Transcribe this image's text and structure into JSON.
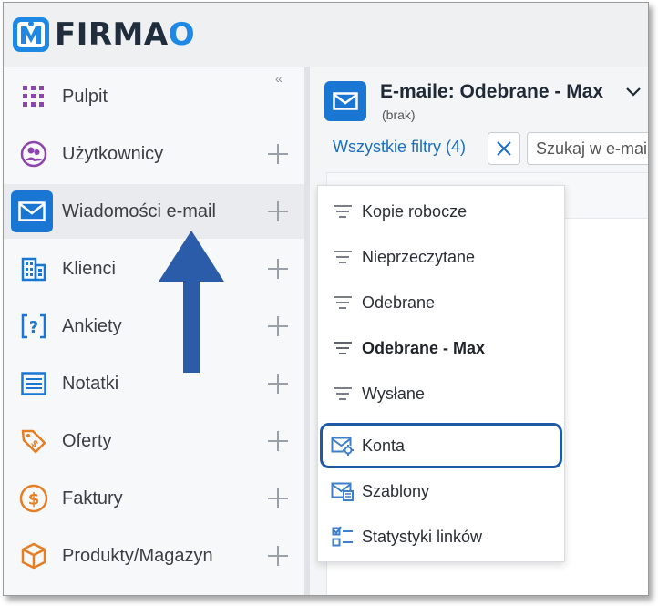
{
  "app": {
    "logo_text": "FIRMAO",
    "brand_color": "#1e88e5"
  },
  "sidebar": {
    "collapse_label": "«",
    "items": [
      {
        "label": "Pulpit",
        "icon": "grid-icon",
        "color": "#8e44ad",
        "has_add": false
      },
      {
        "label": "Użytkownicy",
        "icon": "users-icon",
        "color": "#8e44ad",
        "has_add": true
      },
      {
        "label": "Wiadomości e-mail",
        "icon": "mail-icon",
        "color": "#1976d2",
        "has_add": true,
        "active": true
      },
      {
        "label": "Klienci",
        "icon": "building-icon",
        "color": "#1976d2",
        "has_add": true
      },
      {
        "label": "Ankiety",
        "icon": "survey-icon",
        "color": "#1976d2",
        "has_add": true
      },
      {
        "label": "Notatki",
        "icon": "notes-icon",
        "color": "#1976d2",
        "has_add": true
      },
      {
        "label": "Oferty",
        "icon": "tag-icon",
        "color": "#e67e22",
        "has_add": true
      },
      {
        "label": "Faktury",
        "icon": "dollar-icon",
        "color": "#e67e22",
        "has_add": true
      },
      {
        "label": "Produkty/Magazyn",
        "icon": "box-icon",
        "color": "#e67e22",
        "has_add": true
      }
    ]
  },
  "content": {
    "title": "E-maile: Odebrane - Max",
    "subtitle": "(brak)",
    "filters_link": "Wszystkie filtry (4)",
    "search_placeholder": "Szukaj w e-mailach"
  },
  "menu": {
    "items": [
      {
        "label": "Kopie robocze",
        "icon": "filter-icon"
      },
      {
        "label": "Nieprzeczytane",
        "icon": "filter-icon"
      },
      {
        "label": "Odebrane",
        "icon": "filter-icon"
      },
      {
        "label": "Odebrane - Max",
        "icon": "filter-icon",
        "bold": true
      },
      {
        "label": "Wysłane",
        "icon": "filter-icon"
      },
      {
        "label": "Konta",
        "icon": "mail-settings-icon",
        "highlighted": true
      },
      {
        "label": "Szablony",
        "icon": "mail-template-icon"
      },
      {
        "label": "Statystyki linków",
        "icon": "checklist-icon"
      }
    ]
  },
  "annotation": {
    "arrow_color": "#2a5caa",
    "highlight_color": "#1e5aa8"
  }
}
